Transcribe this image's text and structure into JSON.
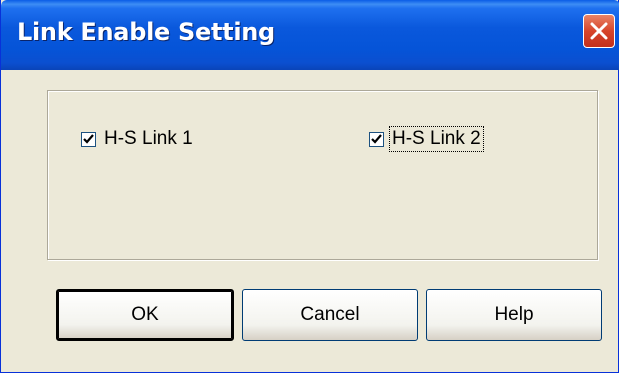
{
  "window": {
    "title": "Link Enable Setting"
  },
  "checkboxes": [
    {
      "label": "H-S Link 1",
      "checked": true
    },
    {
      "label": "H-S Link 2",
      "checked": true
    }
  ],
  "buttons": {
    "ok": "OK",
    "cancel": "Cancel",
    "help": "Help"
  },
  "icons": {
    "close": "close-icon",
    "check": "checkmark-icon"
  },
  "colors": {
    "titlebar": "#0554d8",
    "face": "#ece9d8",
    "close": "#d7452b"
  }
}
